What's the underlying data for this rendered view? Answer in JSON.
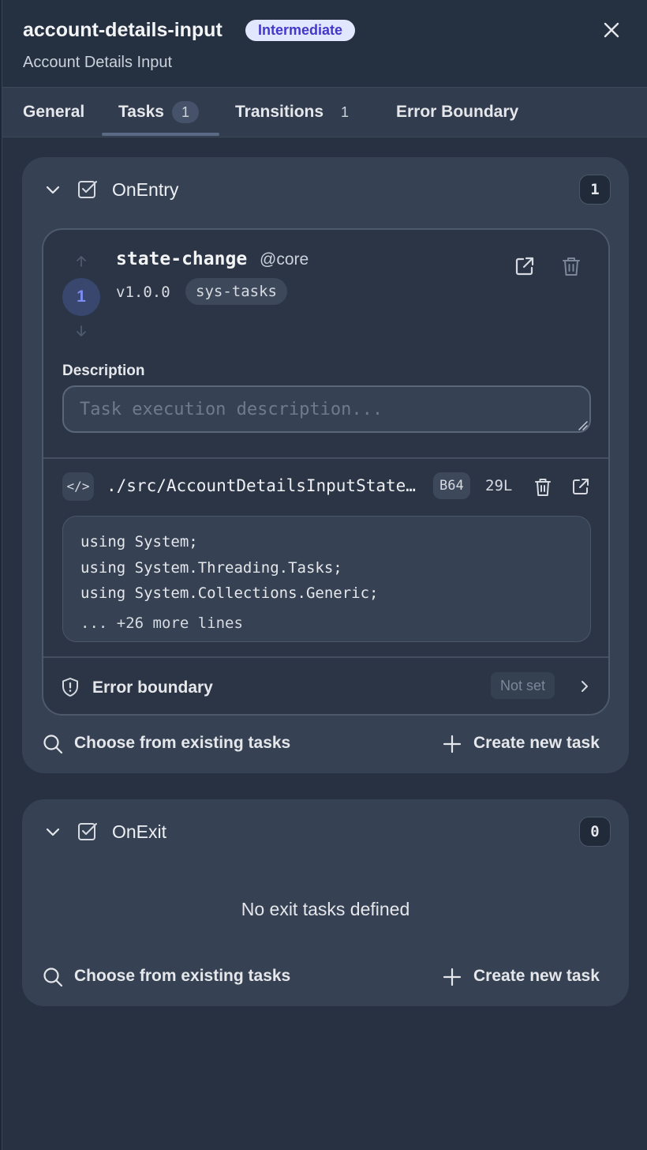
{
  "header": {
    "title": "account-details-input",
    "level_badge": "Intermediate",
    "subtitle": "Account Details Input",
    "close_icon": "close-icon"
  },
  "tabs": [
    {
      "label": "General",
      "count": ""
    },
    {
      "label": "Tasks",
      "count": "1"
    },
    {
      "label": "Transitions",
      "count": "1"
    },
    {
      "label": "Error Boundary",
      "count": ""
    }
  ],
  "active_tab": "Tasks",
  "on_entry": {
    "title": "OnEntry",
    "count": "1",
    "task": {
      "order": "1",
      "name": "state-change",
      "namespace": "@core",
      "version": "v1.0.0",
      "tag": "sys-tasks",
      "description_label": "Description",
      "description_placeholder": "Task execution description...",
      "description_value": "",
      "code_icon_text": "</>",
      "file_path": "./src/AccountDetailsInputStateChange.csx",
      "encoding_badge": "B64",
      "line_count": "29L",
      "code_lines": [
        "using System;",
        "using System.Threading.Tasks;",
        "using System.Collections.Generic;"
      ],
      "code_more": "... +26 more lines",
      "error_boundary_label": "Error boundary",
      "error_boundary_status": "Not set"
    },
    "choose_label": "Choose from existing tasks",
    "create_label": "Create new task"
  },
  "on_exit": {
    "title": "OnExit",
    "count": "0",
    "empty_text": "No exit tasks defined",
    "choose_label": "Choose from existing tasks",
    "create_label": "Create new task"
  },
  "colors": {
    "background": "#273142",
    "card": "#364254",
    "accent_badge_bg": "#e0e7ff",
    "accent_badge_text": "#4338ca",
    "order_circle_text": "#7c8cf0"
  }
}
